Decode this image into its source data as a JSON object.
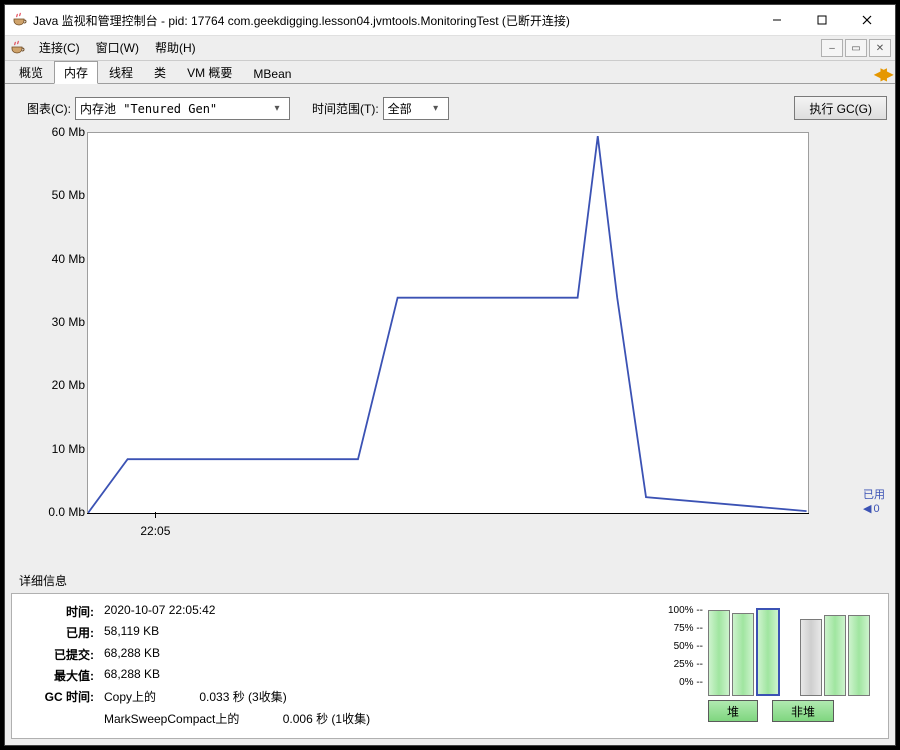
{
  "window": {
    "title": "Java 监视和管理控制台 - pid: 17764 com.geekdigging.lesson04.jvmtools.MonitoringTest (已断开连接)"
  },
  "menubar": {
    "connect": "连接(C)",
    "window": "窗口(W)",
    "help": "帮助(H)"
  },
  "tabs": {
    "overview": "概览",
    "memory": "内存",
    "threads": "线程",
    "classes": "类",
    "vmsummary": "VM 概要",
    "mbean": "MBean"
  },
  "toolbar": {
    "chart_label": "图表(C):",
    "chart_combo": "内存池 \"Tenured Gen\"",
    "range_label": "时间范围(T):",
    "range_combo": "全部",
    "gc_button": "执行 GC(G)"
  },
  "legend": {
    "used_label": "已用",
    "used_value": "0"
  },
  "chart_data": {
    "type": "line",
    "title": "",
    "xlabel": "",
    "ylabel": "Mb",
    "ylim": [
      0,
      60
    ],
    "yticks": [
      0.0,
      10,
      20,
      30,
      40,
      50,
      60
    ],
    "ytick_labels": [
      "0.0 Mb",
      "10 Mb",
      "20 Mb",
      "30 Mb",
      "40 Mb",
      "50 Mb",
      "60 Mb"
    ],
    "xticks": [
      {
        "pos": 0.095,
        "label": "22:05"
      }
    ],
    "series": [
      {
        "name": "已用",
        "color": "#3b52b4",
        "points": [
          {
            "x": 0.0,
            "y": 0.0
          },
          {
            "x": 0.055,
            "y": 8.5
          },
          {
            "x": 0.375,
            "y": 8.5
          },
          {
            "x": 0.43,
            "y": 34.0
          },
          {
            "x": 0.68,
            "y": 34.0
          },
          {
            "x": 0.708,
            "y": 59.5
          },
          {
            "x": 0.735,
            "y": 34.0
          },
          {
            "x": 0.775,
            "y": 2.5
          },
          {
            "x": 0.998,
            "y": 0.3
          }
        ]
      }
    ]
  },
  "details": {
    "header": "详细信息",
    "time_k": "时间:",
    "time_v": "2020-10-07 22:05:42",
    "used_k": "已用:",
    "used_v": "58,119 KB",
    "committed_k": "已提交:",
    "committed_v": "68,288 KB",
    "max_k": "最大值:",
    "max_v": "68,288 KB",
    "gc_k": "GC 时间:",
    "gc1_name": "Copy上的",
    "gc1_val": "0.033 秒 (3收集)",
    "gc2_name": "MarkSweepCompact上的",
    "gc2_val": "0.006 秒 (1收集)"
  },
  "bars": {
    "ylabels": [
      "100%",
      "75%",
      "50%",
      "25%",
      "0%"
    ],
    "heap_btn": "堆",
    "nonheap_btn": "非堆",
    "items": [
      {
        "height": 95,
        "grey": false,
        "active": false,
        "group": 0
      },
      {
        "height": 92,
        "grey": false,
        "active": false,
        "group": 0
      },
      {
        "height": 95,
        "grey": false,
        "active": true,
        "group": 0
      },
      {
        "height": 85,
        "grey": true,
        "active": false,
        "group": 1
      },
      {
        "height": 90,
        "grey": false,
        "active": false,
        "group": 1
      },
      {
        "height": 90,
        "grey": false,
        "active": false,
        "group": 1
      }
    ]
  }
}
